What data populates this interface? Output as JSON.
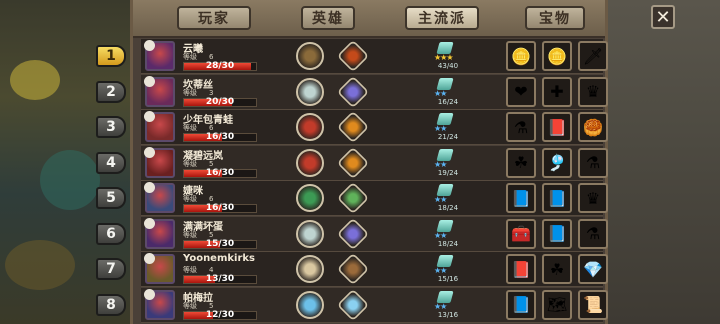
{
  "tabs": [
    "玩家",
    "英雄",
    "主流派",
    "宝物"
  ],
  "active_tab": "主流派",
  "close_label": "✕",
  "heroes": [
    {
      "rank": "1",
      "name": "云曦",
      "level_label": "等级",
      "level": "6",
      "progress": "28/30",
      "progress_fraction": 0.93,
      "stars_label": "★★★",
      "stone_count": "43/40",
      "star_color": "gold",
      "skill_icons": [
        "weapon-skill-icon",
        "flame-skill-icon"
      ],
      "skill_colors": [
        "#8a6a3a",
        "#c44a1a"
      ],
      "equipment": [
        {
          "name": "gold-coin-icon",
          "glyph": "🪙"
        },
        {
          "name": "gold-coin-icon",
          "glyph": "🪙"
        },
        {
          "name": "sword-icon",
          "glyph": "🗡"
        }
      ]
    },
    {
      "rank": "2",
      "name": "坎蒂丝",
      "level_label": "等级",
      "level": "3",
      "progress": "20/30",
      "progress_fraction": 0.67,
      "stars_label": "★★",
      "stone_count": "16/24",
      "star_color": "blue",
      "skill_icons": [
        "skull-skill-icon",
        "arcane-skill-icon"
      ],
      "skill_colors": [
        "#bfd4d0",
        "#7a6fd8"
      ],
      "equipment": [
        {
          "name": "heart-icon",
          "glyph": "❤"
        },
        {
          "name": "medkit-icon",
          "glyph": "✚"
        },
        {
          "name": "crown-icon",
          "glyph": "♛"
        }
      ]
    },
    {
      "rank": "3",
      "name": "少年包青蛙",
      "level_label": "等级",
      "level": "6",
      "progress": "16/30",
      "progress_fraction": 0.53,
      "stars_label": "★★",
      "stone_count": "21/24",
      "star_color": "blue",
      "skill_icons": [
        "fire-orb-skill-icon",
        "fire-arrow-skill-icon"
      ],
      "skill_colors": [
        "#c23b2a",
        "#e08a1e"
      ],
      "equipment": [
        {
          "name": "lantern-icon",
          "glyph": "⚗"
        },
        {
          "name": "book-icon",
          "glyph": "📕"
        },
        {
          "name": "treasure-pile-icon",
          "glyph": "🥮"
        }
      ]
    },
    {
      "rank": "4",
      "name": "凝碧远岚",
      "level_label": "等级",
      "level": "5",
      "progress": "16/30",
      "progress_fraction": 0.53,
      "stars_label": "★★",
      "stone_count": "19/24",
      "star_color": "blue",
      "skill_icons": [
        "fire-orb-skill-icon",
        "fire-arrow-skill-icon"
      ],
      "skill_colors": [
        "#c23b2a",
        "#e08a1e"
      ],
      "equipment": [
        {
          "name": "clover-icon",
          "glyph": "☘"
        },
        {
          "name": "flute-icon",
          "glyph": "🎐"
        },
        {
          "name": "lantern-icon",
          "glyph": "⚗"
        }
      ]
    },
    {
      "rank": "5",
      "name": "婕咪",
      "level_label": "等级",
      "level": "6",
      "progress": "16/30",
      "progress_fraction": 0.53,
      "stars_label": "★★",
      "stone_count": "18/24",
      "star_color": "blue",
      "skill_icons": [
        "crystal-skill-icon",
        "potion-skill-icon"
      ],
      "skill_colors": [
        "#3c9a54",
        "#5fb25a"
      ],
      "equipment": [
        {
          "name": "spellbook-icon",
          "glyph": "📘"
        },
        {
          "name": "spellbook-icon",
          "glyph": "📘"
        },
        {
          "name": "crown-icon",
          "glyph": "♛"
        }
      ]
    },
    {
      "rank": "6",
      "name": "满满坏蛋",
      "level_label": "等级",
      "level": "5",
      "progress": "15/30",
      "progress_fraction": 0.5,
      "stars_label": "★★",
      "stone_count": "18/24",
      "star_color": "blue",
      "skill_icons": [
        "skull-skill-icon",
        "arcane-skill-icon"
      ],
      "skill_colors": [
        "#bfd4d0",
        "#7a6fd8"
      ],
      "equipment": [
        {
          "name": "chest-icon",
          "glyph": "🧰"
        },
        {
          "name": "spellbook-icon",
          "glyph": "📘"
        },
        {
          "name": "lantern-icon",
          "glyph": "⚗"
        }
      ]
    },
    {
      "rank": "7",
      "name": "Yoonemkirks",
      "level_label": "等级",
      "level": "4",
      "progress": "13/30",
      "progress_fraction": 0.43,
      "stars_label": "★★",
      "stone_count": "15/16",
      "star_color": "blue",
      "skill_icons": [
        "scroll-skill-icon",
        "bomb-skill-icon"
      ],
      "skill_colors": [
        "#d9c7a0",
        "#9a6a3a"
      ],
      "equipment": [
        {
          "name": "red-book-icon",
          "glyph": "📕"
        },
        {
          "name": "clover-icon",
          "glyph": "☘"
        },
        {
          "name": "gem-icon",
          "glyph": "💎"
        }
      ]
    },
    {
      "rank": "8",
      "name": "帕梅拉",
      "level_label": "等级",
      "level": "5",
      "progress": "12/30",
      "progress_fraction": 0.4,
      "stars_label": "★★",
      "stone_count": "13/16",
      "star_color": "blue",
      "skill_icons": [
        "ice-skill-icon",
        "ice-crystal-skill-icon"
      ],
      "skill_colors": [
        "#6cc0e8",
        "#8ad0f0"
      ],
      "equipment": [
        {
          "name": "spellbook-icon",
          "glyph": "📘"
        },
        {
          "name": "map-icon",
          "glyph": "🗺"
        },
        {
          "name": "scroll-icon",
          "glyph": "📜"
        }
      ]
    }
  ]
}
